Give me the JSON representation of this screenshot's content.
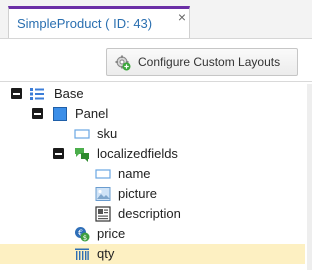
{
  "tab": {
    "title": "SimpleProduct ( ID: 43)",
    "close_glyph": "×"
  },
  "toolbar": {
    "configure_label": "Configure Custom Layouts",
    "configure_icon": "gear-add-icon"
  },
  "tree": [
    {
      "label": "Base",
      "icon": "layout-list-icon",
      "expanded": true
    },
    {
      "label": "Panel",
      "icon": "panel-icon",
      "expanded": true
    },
    {
      "label": "sku",
      "icon": "input-field-icon"
    },
    {
      "label": "localizedfields",
      "icon": "localized-fields-icon",
      "expanded": true
    },
    {
      "label": "name",
      "icon": "input-field-icon"
    },
    {
      "label": "picture",
      "icon": "image-icon"
    },
    {
      "label": "description",
      "icon": "wysiwyg-icon"
    },
    {
      "label": "price",
      "icon": "money-icon"
    },
    {
      "label": "qty",
      "icon": "numeric-icon",
      "selected": true
    }
  ],
  "colors": {
    "tab_accent": "#6b2fa6",
    "selection": "#fdf0c2",
    "link_blue": "#2a6fb0"
  }
}
